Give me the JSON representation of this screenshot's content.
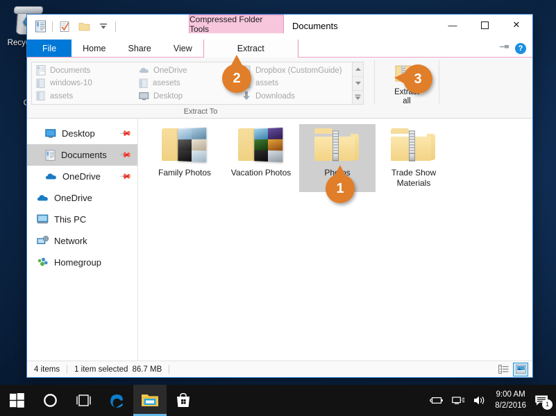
{
  "desktop": {
    "icons": [
      {
        "name": "recycle-bin",
        "label": "Recycle Bin"
      }
    ],
    "guide_text_line1": "E",
    "guide_text_line2": "Gui"
  },
  "window": {
    "title": "Documents",
    "quick_access": [
      {
        "name": "properties-icon",
        "label": "Properties"
      },
      {
        "name": "new-folder-icon",
        "label": "New folder"
      },
      {
        "name": "customize-qat-icon",
        "label": "Customize Quick Access Toolbar"
      }
    ],
    "controls": {
      "minimize": "—",
      "maximize": "☐",
      "close": "✕"
    },
    "contextual_tab_group": "Compressed Folder Tools",
    "tabs": [
      {
        "label": "File",
        "selected": false
      },
      {
        "label": "Home",
        "selected": false
      },
      {
        "label": "Share",
        "selected": false
      },
      {
        "label": "View",
        "selected": false
      },
      {
        "label": "Extract",
        "selected": true
      }
    ],
    "ribbon_right": {
      "pin_label": "Pin the Ribbon",
      "help_label": "?"
    }
  },
  "ribbon": {
    "extract_to": {
      "group_label": "Extract To",
      "columns": [
        [
          {
            "label": "Documents",
            "icon": "document-icon"
          },
          {
            "label": "windows-10",
            "icon": "folder-icon"
          },
          {
            "label": "assets",
            "icon": "folder-icon"
          }
        ],
        [
          {
            "label": "OneDrive",
            "icon": "onedrive-icon"
          },
          {
            "label": "asesets",
            "icon": "folder-icon"
          },
          {
            "label": "Desktop",
            "icon": "desktop-icon"
          }
        ],
        [
          {
            "label": "Dropbox (CustomGuide)",
            "icon": "folder-icon"
          },
          {
            "label": "assets",
            "icon": "folder-icon"
          },
          {
            "label": "Downloads",
            "icon": "downloads-icon"
          }
        ]
      ],
      "scroll_buttons": [
        {
          "name": "gallery-scroll-up",
          "glyph": "▲"
        },
        {
          "name": "gallery-scroll-down",
          "glyph": "▼"
        },
        {
          "name": "gallery-more",
          "glyph": "▼"
        }
      ]
    },
    "extract_all": {
      "label_line1": "Extract",
      "label_line2": "all"
    }
  },
  "nav_pane": {
    "items": [
      {
        "label": "Desktop",
        "icon": "desktop-icon",
        "pinned": true,
        "indent": true,
        "selected": false
      },
      {
        "label": "Documents",
        "icon": "document-icon",
        "pinned": true,
        "indent": true,
        "selected": true
      },
      {
        "label": "OneDrive",
        "icon": "onedrive-icon",
        "pinned": true,
        "indent": true,
        "selected": false
      },
      {
        "label": "OneDrive",
        "icon": "onedrive-icon",
        "pinned": false,
        "indent": false,
        "selected": false
      },
      {
        "label": "This PC",
        "icon": "thispc-icon",
        "pinned": false,
        "indent": false,
        "selected": false
      },
      {
        "label": "Network",
        "icon": "network-icon",
        "pinned": false,
        "indent": false,
        "selected": false
      },
      {
        "label": "Homegroup",
        "icon": "homegroup-icon",
        "pinned": false,
        "indent": false,
        "selected": false
      }
    ],
    "pin_glyph": "✒"
  },
  "files": [
    {
      "name": "Family Photos",
      "kind": "photo-folder",
      "selected": false
    },
    {
      "name": "Vacation Photos",
      "kind": "photo-folder",
      "selected": false
    },
    {
      "name": "Photos",
      "kind": "zipped-folder",
      "selected": true
    },
    {
      "name": "Trade Show Materials",
      "kind": "zipped-folder",
      "selected": false
    }
  ],
  "status_bar": {
    "item_count": "4 items",
    "selection": "1 item selected",
    "size": "86.7 MB",
    "views": [
      {
        "name": "details-view-button",
        "active": false
      },
      {
        "name": "large-icons-view-button",
        "active": true
      }
    ]
  },
  "callouts": [
    {
      "number": "1",
      "direction": "up",
      "target": "photos-folder-tile"
    },
    {
      "number": "2",
      "direction": "up",
      "target": "extract-to-gallery"
    },
    {
      "number": "3",
      "direction": "left",
      "target": "extract-all-button"
    }
  ],
  "taskbar": {
    "buttons": [
      {
        "name": "start-button",
        "icon": "windows-logo-icon",
        "active": false
      },
      {
        "name": "cortana-button",
        "icon": "circle-icon",
        "active": false
      },
      {
        "name": "task-view-button",
        "icon": "task-view-icon",
        "active": false
      },
      {
        "name": "edge-button",
        "icon": "edge-icon",
        "active": false
      },
      {
        "name": "file-explorer-button",
        "icon": "folder-icon",
        "active": true
      },
      {
        "name": "store-button",
        "icon": "store-bag-icon",
        "active": false
      }
    ],
    "tray": {
      "icons": [
        {
          "name": "battery-icon"
        },
        {
          "name": "network-icon"
        },
        {
          "name": "volume-icon"
        }
      ],
      "time": "9:00 AM",
      "date": "8/2/2016",
      "notification_count": "1"
    }
  },
  "colors": {
    "accent_blue": "#0078d7",
    "contextual_pink": "#f7c6dc",
    "callout_orange": "#e07e2a",
    "selection_gray": "#cfcfcf",
    "folder_yellow": "#f6dd9c"
  }
}
